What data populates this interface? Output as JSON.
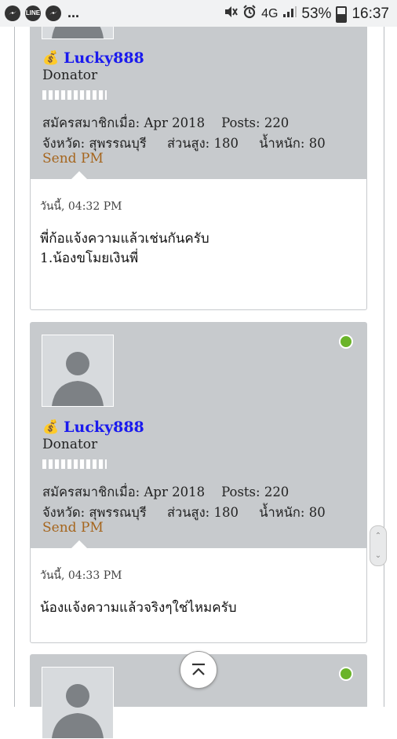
{
  "statusbar": {
    "left_icons": [
      "messenger-icon",
      "line-icon",
      "messenger-icon"
    ],
    "line_label": "LINE",
    "overflow": "...",
    "network": "4G",
    "battery": "53%",
    "time": "16:37"
  },
  "posts": [
    {
      "username": "Lucky888",
      "rank": "Donator",
      "joined": "สมัครสมาชิกเมื่อ: Apr 2018",
      "posts": "Posts: 220",
      "province": "จังหวัด: สุพรรณบุรี",
      "height": "ส่วนสูง: 180",
      "weight": "น้ำหนัก: 80",
      "send_pm": "Send PM",
      "date": "วันนี้, 04:32 PM",
      "message_lines": [
        "พี่ก้อแจ้งความแล้วเช่นกันครับ",
        "1.น้องขโมยเงินพี่"
      ]
    },
    {
      "username": "Lucky888",
      "rank": "Donator",
      "joined": "สมัครสมาชิกเมื่อ: Apr 2018",
      "posts": "Posts: 220",
      "province": "จังหวัด: สุพรรณบุรี",
      "height": "ส่วนสูง: 180",
      "weight": "น้ำหนัก: 80",
      "send_pm": "Send PM",
      "date": "วันนี้, 04:33 PM",
      "message_lines": [
        "น้องแจ้งความแล้วจริงๆใช่ไหมครับ"
      ]
    }
  ],
  "colors": {
    "userbox_bg": "#c7cacd",
    "username": "#1a1aee",
    "send_pm": "#a5651d",
    "online": "#6ab42a"
  }
}
